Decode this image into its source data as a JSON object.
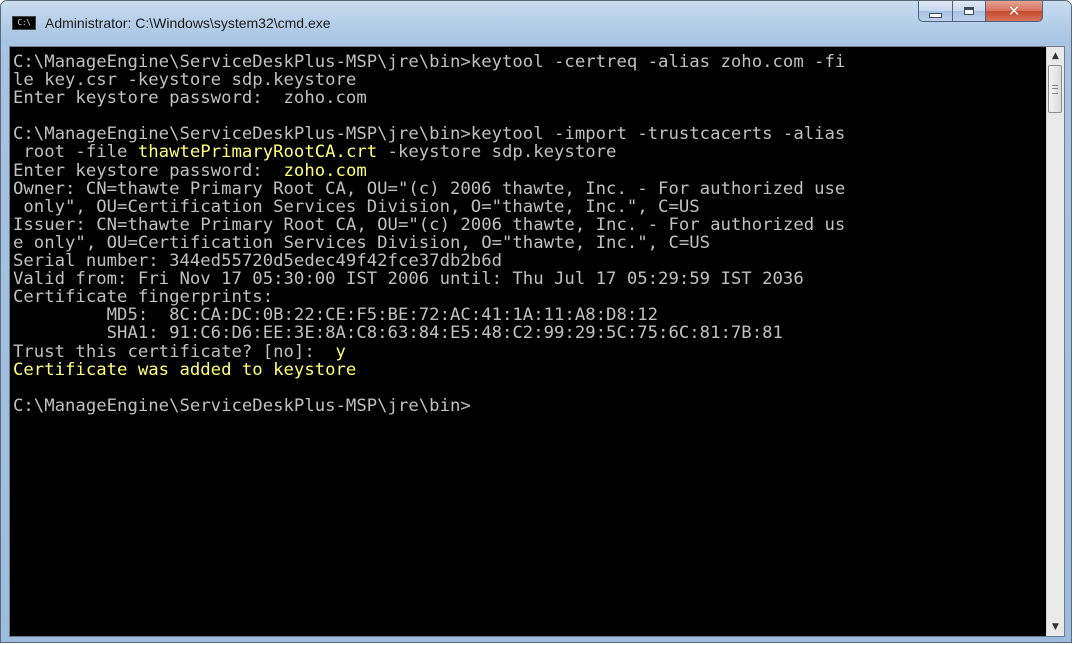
{
  "window": {
    "title": "Administrator: C:\\Windows\\system32\\cmd.exe",
    "icon": "cmd-icon",
    "icon_text": "C:\\"
  },
  "buttons": {
    "minimize": "minimize-icon",
    "maximize": "maximize-icon",
    "close": "close-icon"
  },
  "console": {
    "lines": [
      {
        "segments": [
          {
            "text": "C:\\ManageEngine\\ServiceDeskPlus-MSP\\jre\\bin>keytool -certreq -alias zoho.com -fi",
            "color": "default"
          }
        ]
      },
      {
        "segments": [
          {
            "text": "le key.csr -keystore sdp.keystore",
            "color": "default"
          }
        ]
      },
      {
        "segments": [
          {
            "text": "Enter keystore password:  zoho.com",
            "color": "default"
          }
        ]
      },
      {
        "segments": [
          {
            "text": "",
            "color": "default"
          }
        ]
      },
      {
        "segments": [
          {
            "text": "C:\\ManageEngine\\ServiceDeskPlus-MSP\\jre\\bin>keytool -import -trustcacerts -alias",
            "color": "default"
          }
        ]
      },
      {
        "segments": [
          {
            "text": " root -file ",
            "color": "default"
          },
          {
            "text": "thawtePrimaryRootCA.crt",
            "color": "yellow"
          },
          {
            "text": " -keystore sdp.keystore",
            "color": "default"
          }
        ]
      },
      {
        "segments": [
          {
            "text": "Enter keystore password:  ",
            "color": "default"
          },
          {
            "text": "zoho.com",
            "color": "yellow"
          }
        ]
      },
      {
        "segments": [
          {
            "text": "Owner: CN=thawte Primary Root CA, OU=\"(c) 2006 thawte, Inc. - For authorized use",
            "color": "default"
          }
        ]
      },
      {
        "segments": [
          {
            "text": " only\", OU=Certification Services Division, O=\"thawte, Inc.\", C=US",
            "color": "default"
          }
        ]
      },
      {
        "segments": [
          {
            "text": "Issuer: CN=thawte Primary Root CA, OU=\"(c) 2006 thawte, Inc. - For authorized us",
            "color": "default"
          }
        ]
      },
      {
        "segments": [
          {
            "text": "e only\", OU=Certification Services Division, O=\"thawte, Inc.\", C=US",
            "color": "default"
          }
        ]
      },
      {
        "segments": [
          {
            "text": "Serial number: 344ed55720d5edec49f42fce37db2b6d",
            "color": "default"
          }
        ]
      },
      {
        "segments": [
          {
            "text": "Valid from: Fri Nov 17 05:30:00 IST 2006 until: Thu Jul 17 05:29:59 IST 2036",
            "color": "default"
          }
        ]
      },
      {
        "segments": [
          {
            "text": "Certificate fingerprints:",
            "color": "default"
          }
        ]
      },
      {
        "segments": [
          {
            "text": "         MD5:  8C:CA:DC:0B:22:CE:F5:BE:72:AC:41:1A:11:A8:D8:12",
            "color": "default"
          }
        ]
      },
      {
        "segments": [
          {
            "text": "         SHA1: 91:C6:D6:EE:3E:8A:C8:63:84:E5:48:C2:99:29:5C:75:6C:81:7B:81",
            "color": "default"
          }
        ]
      },
      {
        "segments": [
          {
            "text": "Trust this certificate? [no]:  ",
            "color": "default"
          },
          {
            "text": "y",
            "color": "yellow"
          }
        ]
      },
      {
        "segments": [
          {
            "text": "Certificate was added to keystore",
            "color": "yellow"
          }
        ]
      },
      {
        "segments": [
          {
            "text": "",
            "color": "default"
          }
        ]
      },
      {
        "segments": [
          {
            "text": "C:\\ManageEngine\\ServiceDeskPlus-MSP\\jre\\bin>",
            "color": "default"
          }
        ]
      }
    ]
  },
  "scrollbar": {
    "up": "scroll-up-arrow-icon",
    "down": "scroll-down-arrow-icon",
    "up_glyph": "▲",
    "down_glyph": "▼"
  },
  "colors": {
    "console_bg": "#000000",
    "console_text": "#c0c0c0",
    "highlight": "#ffff00"
  }
}
